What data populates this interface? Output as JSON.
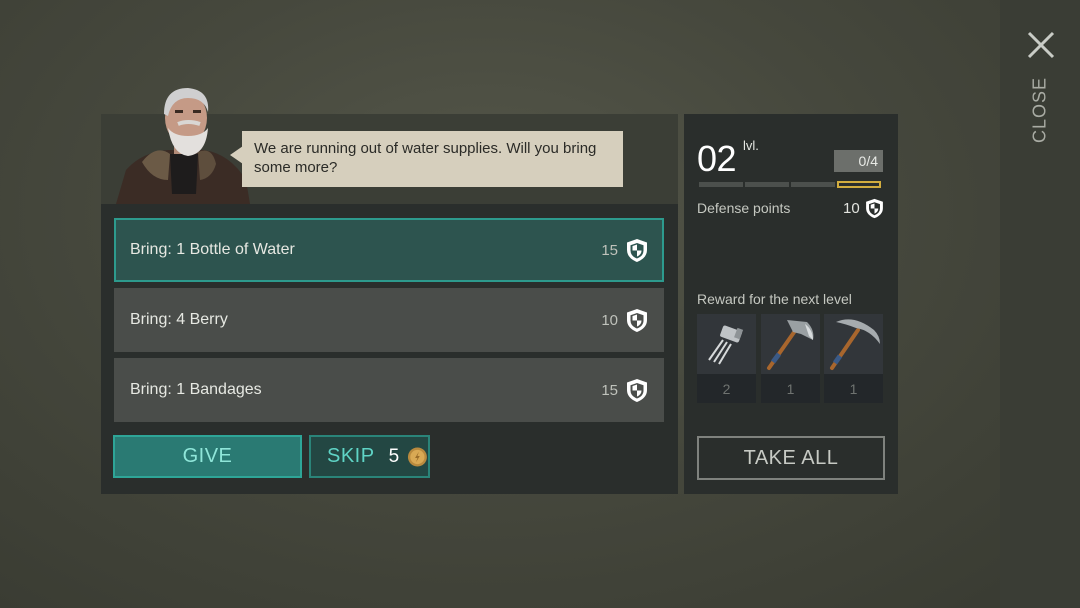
{
  "close": {
    "label": "CLOSE",
    "icon": "close-x-icon"
  },
  "dialog": {
    "speech": "We are running out of water supplies. Will you bring some more?"
  },
  "quests": [
    {
      "label": "Bring: 1 Bottle of Water",
      "points": "15",
      "selected": true
    },
    {
      "label": "Bring: 4 Berry",
      "points": "10",
      "selected": false
    },
    {
      "label": "Bring: 1 Bandages",
      "points": "15",
      "selected": false
    }
  ],
  "actions": {
    "give_label": "GIVE",
    "skip_label": "SKIP",
    "skip_cost": "5"
  },
  "level": {
    "number": "02",
    "unit": "lvl.",
    "progress_text": "0/4",
    "progress_fraction": 0,
    "defense_label": "Defense points",
    "defense_value": "10",
    "reward_label": "Reward for the next level",
    "rewards": [
      {
        "icon": "wires-icon",
        "count": "2"
      },
      {
        "icon": "hatchet-icon",
        "count": "1"
      },
      {
        "icon": "pickaxe-icon",
        "count": "1"
      }
    ],
    "take_all_label": "TAKE ALL"
  },
  "colors": {
    "accent_teal": "#2ea597",
    "progress_gold": "#d2ad3f",
    "speech_bg": "#d6cfbd"
  }
}
